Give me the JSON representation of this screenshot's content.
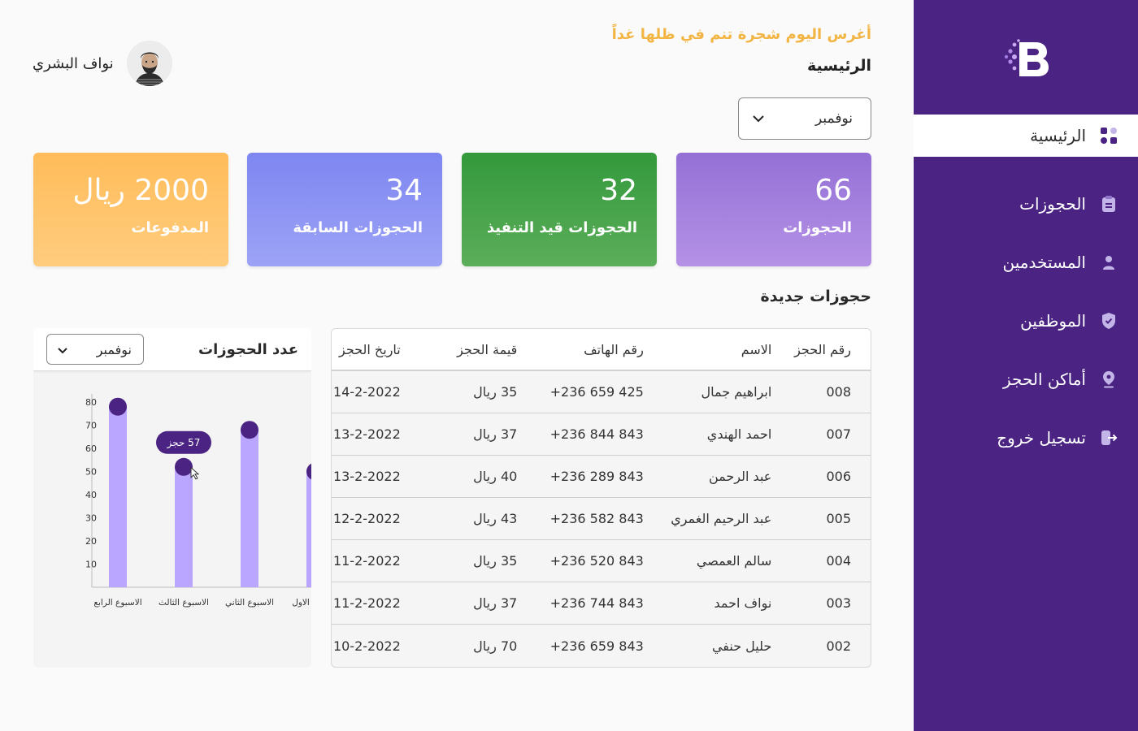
{
  "app": {
    "tagline": "أغرس اليوم شجرة تنم في ظلها غداً",
    "page_title": "الرئيسية"
  },
  "user": {
    "name": "نواف البشري"
  },
  "sidebar": {
    "logo_letter": "B",
    "items": [
      {
        "label": "الرئيسية",
        "icon": "dashboard-icon",
        "active": true
      },
      {
        "label": "الحجوزات",
        "icon": "clipboard-icon",
        "active": false
      },
      {
        "label": "المستخدمين",
        "icon": "user-icon",
        "active": false
      },
      {
        "label": "الموظفين",
        "icon": "shield-icon",
        "active": false
      },
      {
        "label": "أماكن الحجز",
        "icon": "location-pin-icon",
        "active": false
      },
      {
        "label": "تسجيل خروج",
        "icon": "logout-icon",
        "active": false
      }
    ]
  },
  "filter": {
    "month": "نوفمبر"
  },
  "stats": [
    {
      "value": "66",
      "label": "الحجوزات",
      "color_from": "#9470d6",
      "color_to": "#b592e6"
    },
    {
      "value": "32",
      "label": "الحجوزات قيد التنفيذ",
      "color_from": "#33993b",
      "color_to": "#5cae5a"
    },
    {
      "value": "34",
      "label": "الحجوزات السابقة",
      "color_from": "#7e86f1",
      "color_to": "#9ca3f6"
    },
    {
      "value": "2000 ريال",
      "label": "المدفوعات",
      "color_from": "#ffbc5a",
      "color_to": "#ffcc7e"
    }
  ],
  "bookings": {
    "title": "حجوزات جديدة",
    "columns": [
      "رقم الحجز",
      "الاسم",
      "رقم الهاتف",
      "قيمة الحجز",
      "تاريخ الحجز"
    ],
    "rows": [
      {
        "id": "008",
        "name": "ابراهيم جمال",
        "phone": "+236 659 425",
        "price": "35 ريال",
        "date": "14-2-2022"
      },
      {
        "id": "007",
        "name": "احمد الهندي",
        "phone": "+236 844 843",
        "price": "37 ريال",
        "date": "13-2-2022"
      },
      {
        "id": "006",
        "name": "عبد الرحمن",
        "phone": "+236 289 843",
        "price": "40 ريال",
        "date": "13-2-2022"
      },
      {
        "id": "005",
        "name": "عبد الرحيم الغمري",
        "phone": "+236 582 843",
        "price": "43 ريال",
        "date": "12-2-2022"
      },
      {
        "id": "004",
        "name": "سالم العمصي",
        "phone": "+236 520 843",
        "price": "35 ريال",
        "date": "11-2-2022"
      },
      {
        "id": "003",
        "name": "نواف احمد",
        "phone": "+236 744 843",
        "price": "37 ريال",
        "date": "11-2-2022"
      },
      {
        "id": "002",
        "name": "حليل حنفي",
        "phone": "+236 659 843",
        "price": "70 ريال",
        "date": "10-2-2022"
      }
    ]
  },
  "chart_panel": {
    "title": "عدد الحجوزات",
    "month": "نوفمبر",
    "tooltip": "57 حجز"
  },
  "chart_data": {
    "type": "bar",
    "categories": [
      "الاسبوع الرابع",
      "الاسبوع الثالث",
      "الاسبوع الثاني",
      "الاسبوع الاول"
    ],
    "values": [
      78,
      52,
      68,
      50
    ],
    "ylim": [
      0,
      80
    ],
    "yticks": [
      10,
      20,
      30,
      40,
      50,
      60,
      70,
      80
    ],
    "bar_color": "#baa6ff",
    "marker_color": "#4a2383",
    "grid": false
  }
}
